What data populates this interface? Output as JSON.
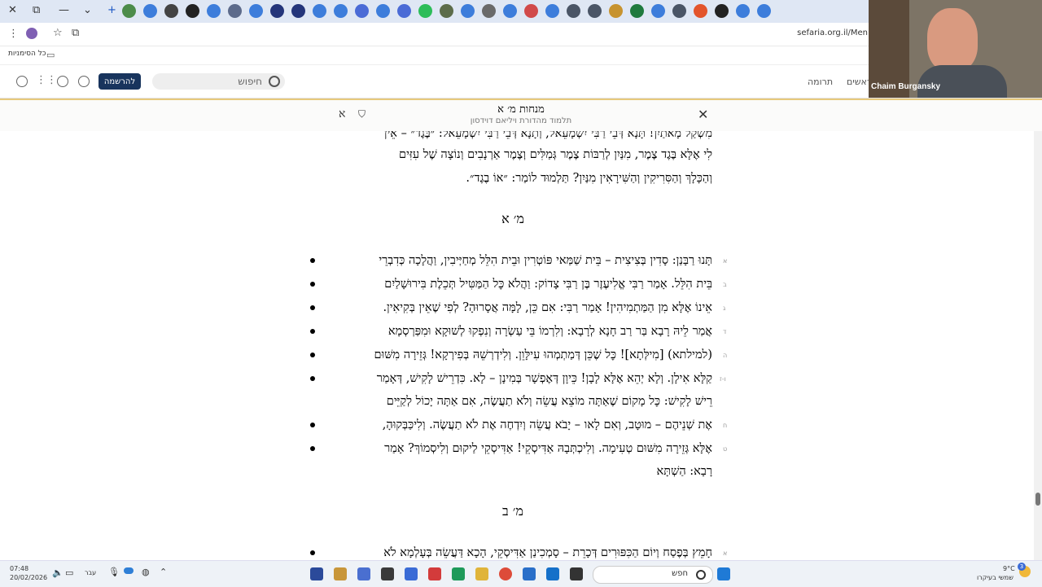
{
  "browser": {
    "url": "sefaria.org.il/Men",
    "bookmarks_label": "כל הסימניות"
  },
  "site_header": {
    "nav_1": "ראשים",
    "nav_2": "תרומה",
    "search_placeholder": "חיפוש",
    "signup_label": "להרשמה"
  },
  "text_bar": {
    "title": "מנחות מ׳ א",
    "subtitle": "תלמוד מהדורת ויליאם דוידסון",
    "font_label": "א"
  },
  "reader": {
    "top_lines": [
      "מִשְׁקַל מָאתַיִן! תָּנָא דְּבֵי רַבִּי יִשְׁמָעֵאל, וְתָנָא דְּבֵי רַבִּי יִשְׁמָעֵאל: ״בֶּגֶד״ – אֵין",
      "לִי אֶלָּא בֶּגֶד צֶמֶר, מִנַּיִן לְרַבּוֹת צֶמֶר גְּמַלִּים וְצֶמֶר אַרְנָבִים וְנוֹצָה שֶׁל עִזִּים",
      "וְהַכָּלָךְ וְהַסִּרִיקִין וְהַשִּׁירָאִין מִנַּיִן? תַּלְמוּד לוֹמַר: ״אוֹ בֶגֶד״."
    ],
    "heading_1": "מ׳ א",
    "segments_1": [
      {
        "num": "א",
        "line": "תָּנוּ רַבָּנַן: סָדִין בְּצִיצִית – בֵּית שַׁמַּאי פּוֹטְרִין וּבֵית הִלֵּל מְחַיְּיבִין, וַהֲלָכָה כְּדִבְרֵי"
      },
      {
        "num": "ב",
        "line": "בֵּית הִלֵּל. אָמַר רַבִּי אֱלִיעֶזֶר בֶּן רַבִּי צָדוֹק: וַהֲלֹא כׇּל הַמַּטִּיל תְּכֵלֶת בִּירוּשָׁלַיִם"
      },
      {
        "num": "ג",
        "line": "אֵינוֹ אֶלָּא מִן הַמַּתְמִיהִין! אָמַר רַבִּי: אִם כֵּן, לָמָּה אֲסָרוּהָ? לְפִי שֶׁאֵין בְּקִיאִין."
      },
      {
        "num": "ד",
        "line": "אֲמַר לֵיהּ רָבָא בַּר רַב חָנָא לְרָבָא: וְלִרְמוֹ בֵּי עַשְׂרָה וְנִפְקוּ לְשׁוּקָא וּמִפַּרְסְמָא"
      },
      {
        "num": "ה",
        "line": "(למילתא) [מִילְּתָא]! כׇּל שֶׁכֵּן דְּמַתְמְהוּ עִילָּוֵן. וְלִידְרְשֵׁהּ בְּפִירְקָא! גְּזֵירָה מִשּׁוּם"
      },
      {
        "num": "ו-ז",
        "line": "קַלָּא אִילָן. וְלָא יְהֵא אֶלָּא לָבָן! כֵּיוָן דְּאֶפְשָׁר בְּמִינָן – לָא. כִּדְרֵישׁ לָקִישׁ, דְּאָמַר"
      },
      {
        "num": "",
        "line": "רֵישׁ לָקִישׁ: כׇּל מָקוֹם שֶׁאַתָּה מוֹצֵא עֲשֵׂה וְלֹא תַעֲשֶׂה, אִם אַתָּה יָכוֹל לְקַיֵּים"
      },
      {
        "num": "ח",
        "line": "אֶת שְׁנֵיהֶם – מוּטָב, וְאִם לָאו – יָבֹא עֲשֵׂה וְיִדְחֶה אֶת לֹא תַעֲשֶׂה. וְלִיכַּבְּקוּהָ,"
      },
      {
        "num": "ט",
        "line": "אֶלָּא גְּזֵירָה מִשּׁוּם טְעִימָה. וְלִיכְתְּבָהּ אַדִּיסְקֵי! אַדִּיסְקֵי לַיקוּם וְלִיסְמוֹךְ? אָמַר"
      },
      {
        "num": "",
        "line": "רָבָא: הַשְׁתָּא"
      }
    ],
    "heading_2": "מ׳ ב",
    "segments_2": [
      {
        "num": "א",
        "line": "חָמֵץ בְּפֶסַח וְיוֹם הַכִּפּוּרִים דְּכָרֵת – סָמְכִינַן אַדִּיסְקֵי, הָכָא דַּעֲשֵׂה בְּעָלְמָא לֹא"
      }
    ]
  },
  "video_overlay": {
    "name": "Chaim Burgansky"
  },
  "taskbar": {
    "time": "07:48",
    "date": "20/02/2026",
    "lang": "עבר",
    "search_label": "חפש",
    "weather_temp": "9°C",
    "weather_text": "שמשי בעיקרו",
    "notifications": "3"
  },
  "colors": {
    "accent_gold": "#e7c97b",
    "signup_bg": "#18345d"
  }
}
